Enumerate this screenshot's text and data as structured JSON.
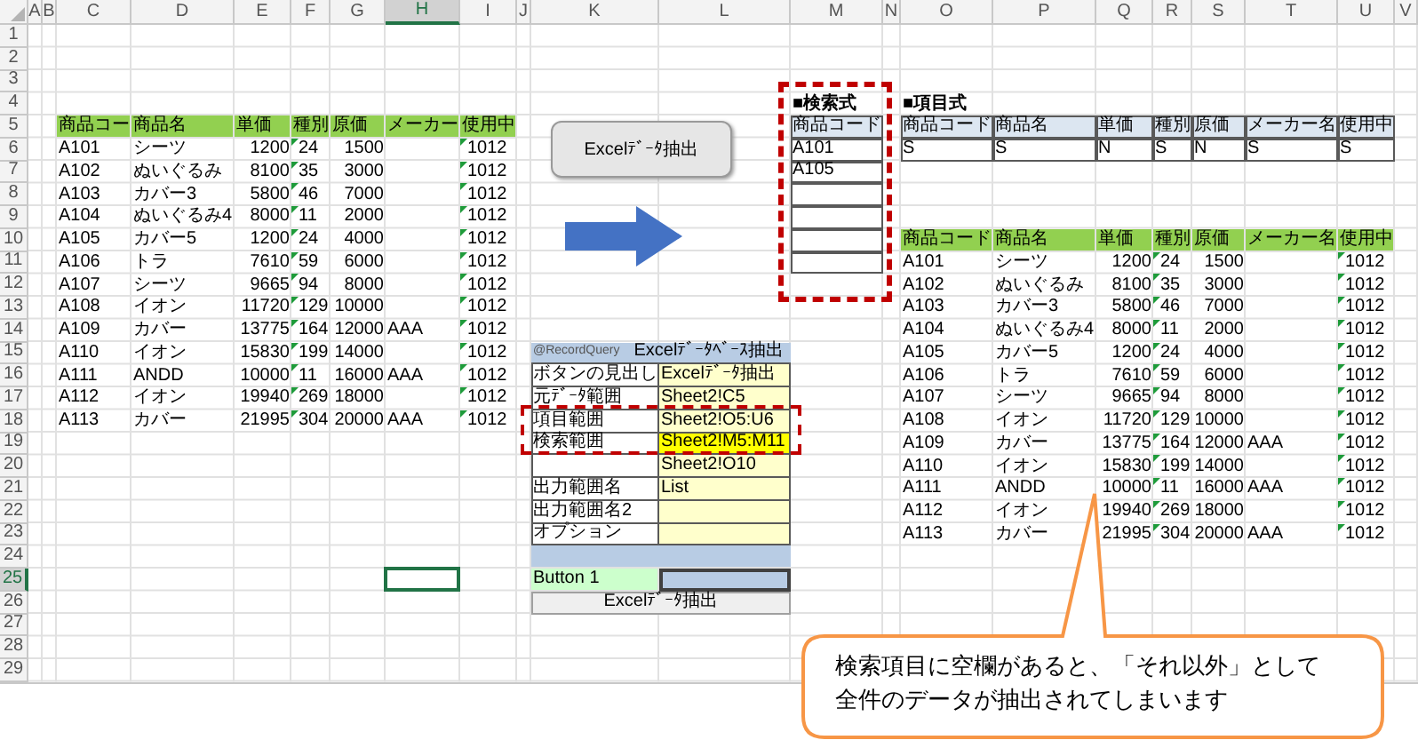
{
  "column_headers": [
    {
      "label": "A",
      "selected": false
    },
    {
      "label": "B",
      "selected": false
    },
    {
      "label": "C",
      "selected": false
    },
    {
      "label": "D",
      "selected": false
    },
    {
      "label": "E",
      "selected": false
    },
    {
      "label": "F",
      "selected": false
    },
    {
      "label": "G",
      "selected": false
    },
    {
      "label": "H",
      "selected": true
    },
    {
      "label": "I",
      "selected": false
    },
    {
      "label": "J",
      "selected": false
    },
    {
      "label": "K",
      "selected": false
    },
    {
      "label": "L",
      "selected": false
    },
    {
      "label": "M",
      "selected": false
    },
    {
      "label": "N",
      "selected": false
    },
    {
      "label": "O",
      "selected": false
    },
    {
      "label": "P",
      "selected": false
    },
    {
      "label": "Q",
      "selected": false
    },
    {
      "label": "R",
      "selected": false
    },
    {
      "label": "S",
      "selected": false
    },
    {
      "label": "T",
      "selected": false
    },
    {
      "label": "U",
      "selected": false
    },
    {
      "label": "V",
      "selected": false
    }
  ],
  "row_headers": [
    {
      "label": "1",
      "selected": false
    },
    {
      "label": "2",
      "selected": false
    },
    {
      "label": "3",
      "selected": false
    },
    {
      "label": "4",
      "selected": false
    },
    {
      "label": "5",
      "selected": false
    },
    {
      "label": "6",
      "selected": false
    },
    {
      "label": "7",
      "selected": false
    },
    {
      "label": "8",
      "selected": false
    },
    {
      "label": "9",
      "selected": false
    },
    {
      "label": "10",
      "selected": false
    },
    {
      "label": "11",
      "selected": false
    },
    {
      "label": "12",
      "selected": false
    },
    {
      "label": "13",
      "selected": false
    },
    {
      "label": "14",
      "selected": false
    },
    {
      "label": "15",
      "selected": false
    },
    {
      "label": "16",
      "selected": false
    },
    {
      "label": "17",
      "selected": false
    },
    {
      "label": "18",
      "selected": false
    },
    {
      "label": "19",
      "selected": false
    },
    {
      "label": "20",
      "selected": false
    },
    {
      "label": "21",
      "selected": false
    },
    {
      "label": "22",
      "selected": false
    },
    {
      "label": "23",
      "selected": false
    },
    {
      "label": "24",
      "selected": false
    },
    {
      "label": "25",
      "selected": true
    },
    {
      "label": "26",
      "selected": false
    },
    {
      "label": "27",
      "selected": false
    },
    {
      "label": "28",
      "selected": false
    },
    {
      "label": "29",
      "selected": false
    }
  ],
  "product_table": {
    "columns": [
      "商品コー",
      "商品名",
      "単価",
      "種別",
      "原価",
      "メーカー",
      "使用中"
    ],
    "rows": [
      [
        "A101",
        "シーツ",
        "1200",
        "24",
        "1500",
        null,
        "1012"
      ],
      [
        "A102",
        "ぬいぐるみ",
        "8100",
        "35",
        "3000",
        null,
        "1012"
      ],
      [
        "A103",
        "カバー3",
        "5800",
        "46",
        "7000",
        null,
        "1012"
      ],
      [
        "A104",
        "ぬいぐるみ4",
        "8000",
        "11",
        "2000",
        null,
        "1012"
      ],
      [
        "A105",
        "カバー5",
        "1200",
        "24",
        "4000",
        null,
        "1012"
      ],
      [
        "A106",
        "トラ",
        "7610",
        "59",
        "6000",
        null,
        "1012"
      ],
      [
        "A107",
        "シーツ",
        "9665",
        "94",
        "8000",
        null,
        "1012"
      ],
      [
        "A108",
        "イオン",
        "11720",
        "129",
        "10000",
        null,
        "1012"
      ],
      [
        "A109",
        "カバー",
        "13775",
        "164",
        "12000",
        "AAA",
        "1012"
      ],
      [
        "A110",
        "イオン",
        "15830",
        "199",
        "14000",
        null,
        "1012"
      ],
      [
        "A111",
        "ANDD",
        "10000",
        "11",
        "16000",
        "AAA",
        "1012"
      ],
      [
        "A112",
        "イオン",
        "19940",
        "269",
        "18000",
        null,
        "1012"
      ],
      [
        "A113",
        "カバー",
        "21995",
        "304",
        "20000",
        "AAA",
        "1012"
      ]
    ]
  },
  "extract_button": {
    "label": "Excelﾃﾞｰﾀ抽出"
  },
  "search_criteria": {
    "title": "■検索式",
    "column": "商品コード",
    "values": [
      "A101",
      "A105"
    ]
  },
  "item_format": {
    "title": "■項目式",
    "columns": [
      "商品コード",
      "商品名",
      "単価",
      "種別",
      "原価",
      "メーカー名",
      "使用中"
    ],
    "values": [
      "S",
      "S",
      "N",
      "S",
      "N",
      "S",
      "S"
    ]
  },
  "result_table": {
    "columns": [
      "商品コード",
      "商品名",
      "単価",
      "種別",
      "原価",
      "メーカー名",
      "使用中"
    ],
    "rows": [
      [
        "A101",
        "シーツ",
        "1200",
        "24",
        "1500",
        null,
        "1012"
      ],
      [
        "A102",
        "ぬいぐるみ",
        "8100",
        "35",
        "3000",
        null,
        "1012"
      ],
      [
        "A103",
        "カバー3",
        "5800",
        "46",
        "7000",
        null,
        "1012"
      ],
      [
        "A104",
        "ぬいぐるみ4",
        "8000",
        "11",
        "2000",
        null,
        "1012"
      ],
      [
        "A105",
        "カバー5",
        "1200",
        "24",
        "4000",
        null,
        "1012"
      ],
      [
        "A106",
        "トラ",
        "7610",
        "59",
        "6000",
        null,
        "1012"
      ],
      [
        "A107",
        "シーツ",
        "9665",
        "94",
        "8000",
        null,
        "1012"
      ],
      [
        "A108",
        "イオン",
        "11720",
        "129",
        "10000",
        null,
        "1012"
      ],
      [
        "A109",
        "カバー",
        "13775",
        "164",
        "12000",
        "AAA",
        "1012"
      ],
      [
        "A110",
        "イオン",
        "15830",
        "199",
        "14000",
        null,
        "1012"
      ],
      [
        "A111",
        "ANDD",
        "10000",
        "11",
        "16000",
        "AAA",
        "1012"
      ],
      [
        "A112",
        "イオン",
        "19940",
        "269",
        "18000",
        null,
        "1012"
      ],
      [
        "A113",
        "カバー",
        "21995",
        "304",
        "20000",
        "AAA",
        "1012"
      ]
    ]
  },
  "query_settings": {
    "header": [
      "@RecordQuery",
      "Excelﾃﾞｰﾀﾍﾞｰｽ抽出"
    ],
    "rows": [
      {
        "label": "ボタンの見出し",
        "value": "Excelﾃﾞｰﾀ抽出",
        "highlighted": false
      },
      {
        "label": "元ﾃﾞｰﾀ範囲",
        "value": "Sheet2!C5",
        "highlighted": false
      },
      {
        "label": "項目範囲",
        "value": "Sheet2!O5:U6",
        "highlighted": false
      },
      {
        "label": "検索範囲",
        "value": "Sheet2!M5:M11",
        "highlighted": true
      },
      {
        "value": "Sheet2!O10",
        "highlighted": false
      },
      {
        "label": "出力範囲名",
        "value": "List",
        "highlighted": false
      },
      {
        "label": "出力範囲名2",
        "highlighted": false
      },
      {
        "label": "オプション",
        "highlighted": false
      }
    ],
    "button_cell": "Button 1",
    "run_button": "Excelﾃﾞｰﾀ抽出"
  },
  "callout": {
    "lines": [
      "検索項目に空欄があると、「それ以外」として",
      "全件のデータが抽出されてしまいます"
    ]
  }
}
